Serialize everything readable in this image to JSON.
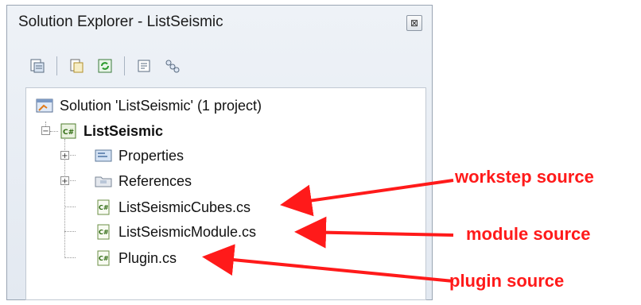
{
  "window": {
    "title": "Solution Explorer - ListSeismic",
    "close_label": "⊠"
  },
  "toolbar": {
    "buttons": [
      "properties-icon",
      "show-all-files-icon",
      "refresh-icon",
      "view-code-icon",
      "class-view-icon"
    ]
  },
  "tree": {
    "solution": "Solution 'ListSeismic' (1 project)",
    "project": "ListSeismic",
    "properties": "Properties",
    "references": "References",
    "file1": "ListSeismicCubes.cs",
    "file2": "ListSeismicModule.cs",
    "file3": "Plugin.cs",
    "project_icon_text": "C#"
  },
  "annotations": {
    "a1": "workstep source",
    "a2": "module source",
    "a3": "plugin source",
    "color": "#ff1a1a"
  }
}
